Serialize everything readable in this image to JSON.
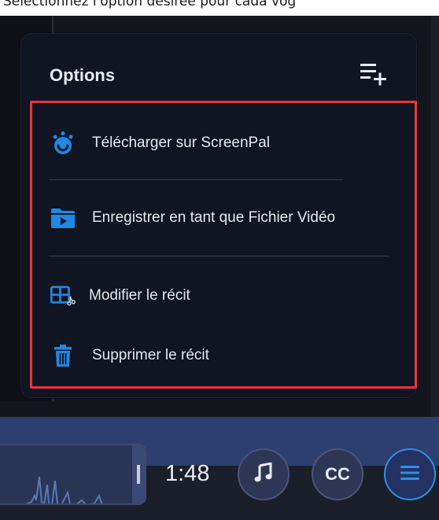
{
  "top_strip": {
    "text": "Sélectionnez l'option désirée pour cada vog"
  },
  "panel": {
    "title": "Options",
    "add_icon": "playlist-add-icon",
    "items": [
      {
        "label": "Télécharger sur ScreenPal",
        "icon": "screenpal-upload-icon"
      },
      {
        "label": "Enregistrer en tant que Fichier Vidéo",
        "icon": "video-folder-icon"
      },
      {
        "label": "Modifier le récit",
        "icon": "edit-cut-grid-icon"
      },
      {
        "label": "Supprimer le récit",
        "icon": "trash-icon"
      }
    ]
  },
  "player": {
    "time": "1:48",
    "music_icon": "music-note-icon",
    "cc_label": "CC",
    "menu_icon": "menu-icon"
  },
  "colors": {
    "accent_blue": "#2f8fe8",
    "highlight_red": "#e8343c",
    "panel_bg": "#111522"
  }
}
